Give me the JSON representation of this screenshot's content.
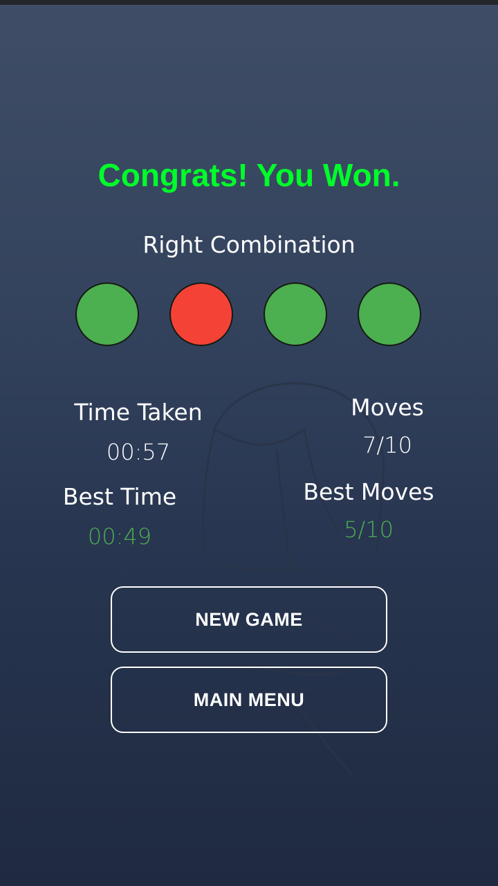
{
  "result": {
    "title": "Congrats! You Won.",
    "title_color": "#00ff2a"
  },
  "combination": {
    "label": "Right Combination",
    "pegs": [
      {
        "color_name": "green",
        "color": "#4caf50"
      },
      {
        "color_name": "red",
        "color": "#f44336"
      },
      {
        "color_name": "green",
        "color": "#4caf50"
      },
      {
        "color_name": "green",
        "color": "#4caf50"
      }
    ]
  },
  "stats": {
    "time_taken_label": "Time Taken",
    "time_taken_value": "00:57",
    "best_time_label": "Best Time",
    "best_time_value": "00:49",
    "moves_label": "Moves",
    "moves_value": "7/10",
    "best_moves_label": "Best Moves",
    "best_moves_value": "5/10",
    "best_value_color": "#4caf50"
  },
  "buttons": {
    "new_game": "NEW GAME",
    "main_menu": "MAIN MENU"
  }
}
